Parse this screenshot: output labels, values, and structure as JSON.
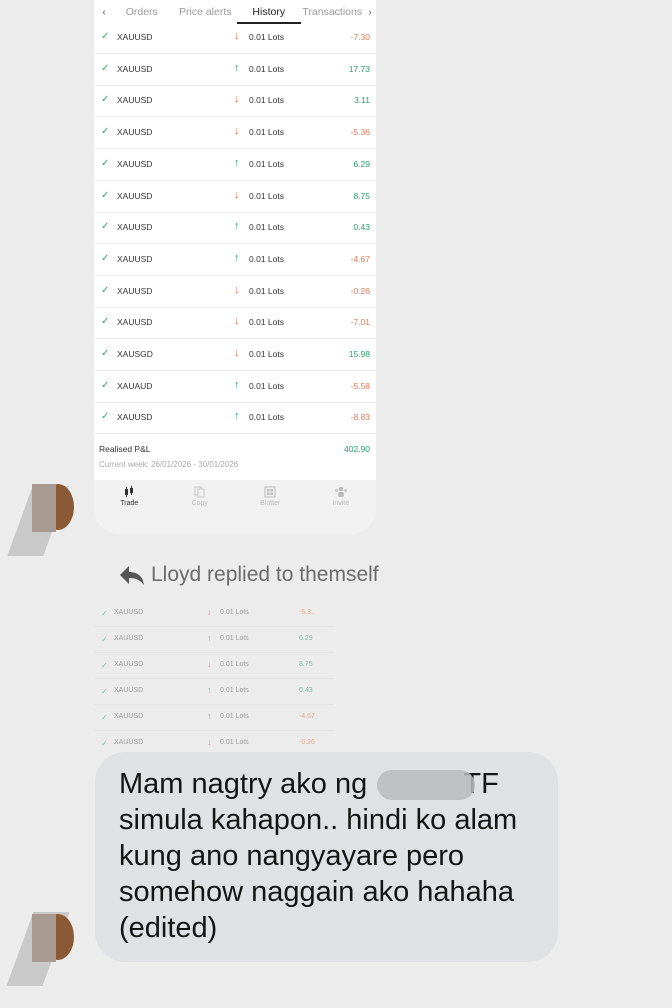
{
  "tabs": {
    "prev": "‹",
    "next": "›",
    "items": [
      "Orders",
      "Price alerts",
      "History",
      "Transactions"
    ],
    "active": "History"
  },
  "trades": [
    {
      "symbol": "XAUUSD",
      "dir": "down",
      "lots": "0.01 Lots",
      "pl": "-7.30"
    },
    {
      "symbol": "XAUUSD",
      "dir": "up",
      "lots": "0.01 Lots",
      "pl": "17.73"
    },
    {
      "symbol": "XAUUSD",
      "dir": "down",
      "lots": "0.01 Lots",
      "pl": "3.11"
    },
    {
      "symbol": "XAUUSD",
      "dir": "down",
      "lots": "0.01 Lots",
      "pl": "-5.36"
    },
    {
      "symbol": "XAUUSD",
      "dir": "up",
      "lots": "0.01 Lots",
      "pl": "6.29"
    },
    {
      "symbol": "XAUUSD",
      "dir": "down",
      "lots": "0.01 Lots",
      "pl": "8.75"
    },
    {
      "symbol": "XAUUSD",
      "dir": "up",
      "lots": "0.01 Lots",
      "pl": "0.43"
    },
    {
      "symbol": "XAUUSD",
      "dir": "up",
      "lots": "0.01 Lots",
      "pl": "-4.67"
    },
    {
      "symbol": "XAUUSD",
      "dir": "down",
      "lots": "0.01 Lots",
      "pl": "-0.26"
    },
    {
      "symbol": "XAUUSD",
      "dir": "down",
      "lots": "0.01 Lots",
      "pl": "-7.01"
    },
    {
      "symbol": "XAUSGD",
      "dir": "down",
      "lots": "0.01 Lots",
      "pl": "15.98"
    },
    {
      "symbol": "XAUAUD",
      "dir": "up",
      "lots": "0.01 Lots",
      "pl": "-5.58"
    },
    {
      "symbol": "XAUUSD",
      "dir": "up",
      "lots": "0.01 Lots",
      "pl": "-8.83"
    }
  ],
  "summary": {
    "realised_label": "Realised P&L",
    "realised_value": "402.90",
    "week": "Current week: 26/01/2026 - 30/01/2026"
  },
  "bottom_nav": [
    {
      "icon": "candlestick-icon",
      "label": "Trade",
      "active": true
    },
    {
      "icon": "copy-icon",
      "label": "Copy",
      "active": false
    },
    {
      "icon": "blotter-icon",
      "label": "Blotter",
      "active": false
    },
    {
      "icon": "invite-icon",
      "label": "Invite",
      "active": false
    }
  ],
  "reply": {
    "text": "Lloyd replied to themself",
    "icon": "reply-arrow-icon"
  },
  "quoted_trades": [
    {
      "symbol": "XAUUSD",
      "dir": "down",
      "lots": "0.01 Lots",
      "pl": "-5.3.."
    },
    {
      "symbol": "XAUUSD",
      "dir": "up",
      "lots": "0.01 Lots",
      "pl": "6.29"
    },
    {
      "symbol": "XAUUSD",
      "dir": "down",
      "lots": "0.01 Lots",
      "pl": "8.75"
    },
    {
      "symbol": "XAUUSD",
      "dir": "up",
      "lots": "0.01 Lots",
      "pl": "0.43"
    },
    {
      "symbol": "XAUUSD",
      "dir": "up",
      "lots": "0.01 Lots",
      "pl": "-4.67"
    },
    {
      "symbol": "XAUUSD",
      "dir": "down",
      "lots": "0.01 Lots",
      "pl": "-0.26"
    }
  ],
  "message": {
    "text": "Mam nagtry ako ng            TF\nsimula kahapon.. hindi ko alam\nkung ano nangyayare pero\nsomehow naggain ako hahaha\n(edited)"
  },
  "colors": {
    "profit": "#28a06b",
    "loss": "#e07a55",
    "bubble": "#dfe1e4",
    "background": "#ececec"
  }
}
